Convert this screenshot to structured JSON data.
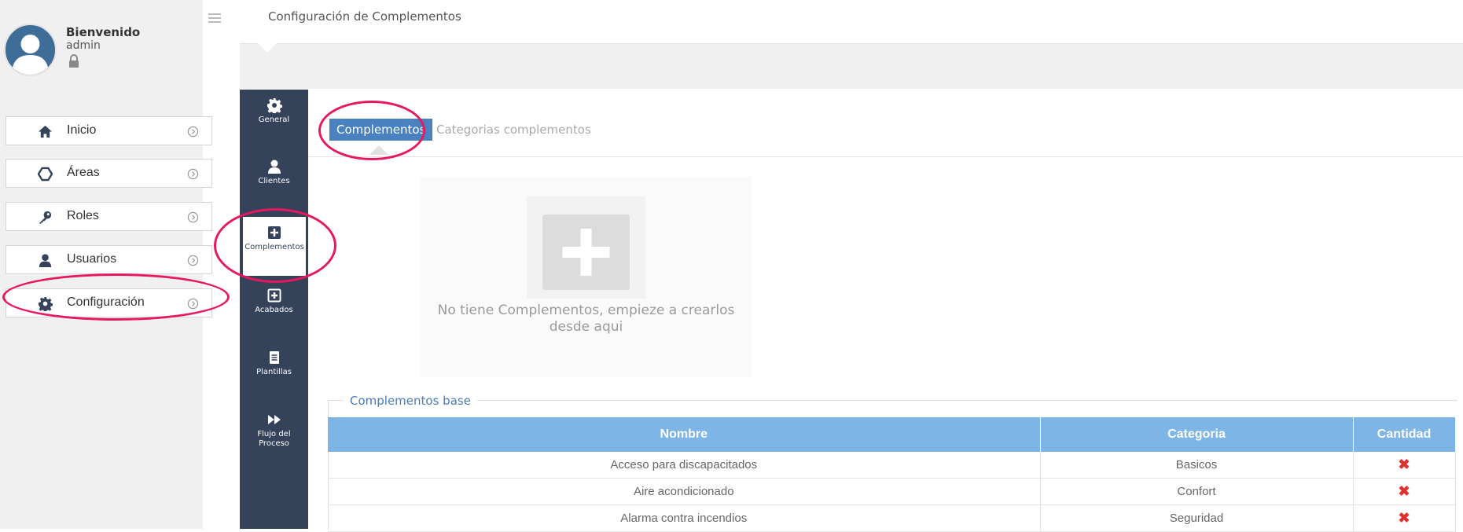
{
  "user": {
    "welcome": "Bienvenido",
    "name": "admin"
  },
  "sidebar": {
    "items": [
      {
        "label": "Inicio",
        "icon": "home-icon"
      },
      {
        "label": "Áreas",
        "icon": "hexagon-icon"
      },
      {
        "label": "Roles",
        "icon": "key-icon"
      },
      {
        "label": "Usuarios",
        "icon": "user-icon"
      },
      {
        "label": "Configuración",
        "icon": "gear-icon"
      }
    ]
  },
  "header": {
    "title": "Configuración de Complementos"
  },
  "toolbar": {
    "items": [
      {
        "label": "General",
        "icon": "gear-icon"
      },
      {
        "label": "Clientes",
        "icon": "users-icon"
      },
      {
        "label": "Complementos",
        "icon": "plus-square-icon"
      },
      {
        "label": "Acabados",
        "icon": "plus-square-outline-icon"
      },
      {
        "label": "Plantillas",
        "icon": "document-icon"
      },
      {
        "label": "Flujo del Proceso",
        "icon": "fast-forward-icon"
      }
    ],
    "active": "Complementos"
  },
  "tabs": {
    "active": "Complementos",
    "other": "Categorias complementos"
  },
  "empty_state": {
    "message": "No tiene Complementos, empieze a crearlos desde aqui"
  },
  "base": {
    "legend": "Complementos base",
    "columns": [
      "Nombre",
      "Categoria",
      "Cantidad"
    ],
    "rows": [
      {
        "nombre": "Acceso para discapacitados",
        "categoria": "Basicos"
      },
      {
        "nombre": "Aire acondicionado",
        "categoria": "Confort"
      },
      {
        "nombre": "Alarma contra incendios",
        "categoria": "Seguridad"
      }
    ]
  },
  "colors": {
    "toolbar": "#34425a",
    "accent": "#4a81c1",
    "table_header": "#7cb5e6",
    "highlight": "#e8185f",
    "delete": "#e03131"
  }
}
